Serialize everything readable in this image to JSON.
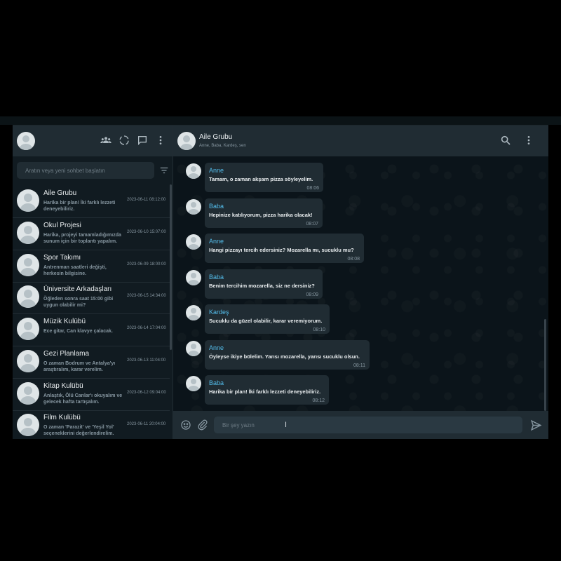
{
  "sidebar": {
    "search_placeholder": "Aratın veya yeni sohbet başlatın",
    "icons": [
      "avatar",
      "community-icon",
      "status-icon",
      "new-chat-icon",
      "menu-icon",
      "filter-icon"
    ],
    "chats": [
      {
        "name": "Aile Grubu",
        "preview": "Harika bir plan! İki farklı lezzeti deneyebiliriz.",
        "time": "2023-06-11 08:12:00"
      },
      {
        "name": "Okul Projesi",
        "preview": "Harika, projeyi tamamladığımızda sunum için bir toplantı yapalım.",
        "time": "2023-06-10 15:07:00"
      },
      {
        "name": "Spor Takımı",
        "preview": "Antrenman saatleri değişti, herkesin bilgisine.",
        "time": "2023-06-09 18:00:00"
      },
      {
        "name": "Üniversite Arkadaşları",
        "preview": "Öğleden sonra saat 15:00 gibi uygun olabilir mi?",
        "time": "2023-06-15 14:34:00"
      },
      {
        "name": "Müzik Kulübü",
        "preview": "Ece gitar, Can klavye çalacak.",
        "time": "2023-06-14 17:04:00"
      },
      {
        "name": "Gezi Planlama",
        "preview": "O zaman Bodrum ve Antalya'yı araştıralım, karar verelim.",
        "time": "2023-06-13 11:04:00"
      },
      {
        "name": "Kitap Kulübü",
        "preview": "Anlaştık, Ölü Canlar'ı okuyalım ve gelecek hafta tartışalım.",
        "time": "2023-06-12 09:04:00"
      },
      {
        "name": "Film Kulübü",
        "preview": "O zaman 'Parazit' ve 'Yeşil Yol' seçeneklerini değerlendirelim.",
        "time": "2023-06-11 20:04:00"
      }
    ]
  },
  "conversation": {
    "title": "Aile Grubu",
    "participants": "Anne, Baba, Kardeş, sen",
    "messages": [
      {
        "sender": "Anne",
        "text": "Tamam, o zaman akşam pizza söyleyelim.",
        "time": "08:06"
      },
      {
        "sender": "Baba",
        "text": "Hepinize katılıyorum, pizza harika olacak!",
        "time": "08:07"
      },
      {
        "sender": "Anne",
        "text": "Hangi pizzayı tercih edersiniz? Mozarella mı, sucuklu mu?",
        "time": "08:08"
      },
      {
        "sender": "Baba",
        "text": "Benim tercihim mozarella, siz ne dersiniz?",
        "time": "08:09"
      },
      {
        "sender": "Kardeş",
        "text": "Sucuklu da güzel olabilir, karar veremiyorum.",
        "time": "08:10"
      },
      {
        "sender": "Anne",
        "text": "Öyleyse ikiye bölelim. Yarısı mozarella, yarısı sucuklu olsun.",
        "time": "08:11"
      },
      {
        "sender": "Baba",
        "text": "Harika bir plan! İki farklı lezzeti deneyebiliriz.",
        "time": "08:12"
      }
    ],
    "input_placeholder": "Bir şey yazın"
  },
  "colors": {
    "panel": "#111b21",
    "header": "#202c33",
    "bubble": "#202c33",
    "sender": "#53bdeb",
    "text": "#e9edef",
    "muted": "#8696a0"
  }
}
